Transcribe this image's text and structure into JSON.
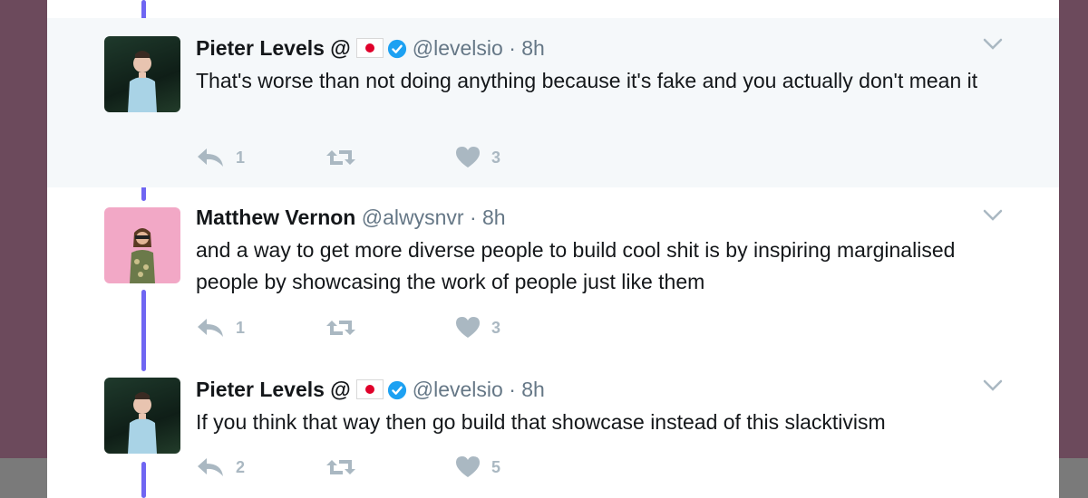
{
  "tweets": [
    {
      "name": "Pieter Levels @",
      "handle": "@levelsio",
      "time": "· 8h",
      "text": "That's worse than not doing anything because it's fake and you actually don't mean it",
      "replies": "1",
      "retweets": "",
      "likes": "3"
    },
    {
      "name": "Matthew Vernon",
      "handle": "@alwysnvr",
      "time": "· 8h",
      "text": "and a way to get more diverse people to build cool shit is by inspiring marginalised people by showcasing the work of people just like them",
      "replies": "1",
      "retweets": "",
      "likes": "3"
    },
    {
      "name": "Pieter Levels @",
      "handle": "@levelsio",
      "time": "· 8h",
      "text": "If you think that way then go build that showcase instead of this slacktivism",
      "replies": "2",
      "retweets": "",
      "likes": "5"
    }
  ],
  "icons": {
    "reply": "reply-icon",
    "retweet": "retweet-icon",
    "like": "heart-icon",
    "menu": "chevron-down-icon",
    "verified": "verified-badge-icon",
    "flag": "japan-flag-icon"
  },
  "colors": {
    "thread_line": "#6f66f2",
    "verified": "#1da1f2",
    "muted": "#aab8c2",
    "highlight_bg": "#f5f8fa"
  }
}
